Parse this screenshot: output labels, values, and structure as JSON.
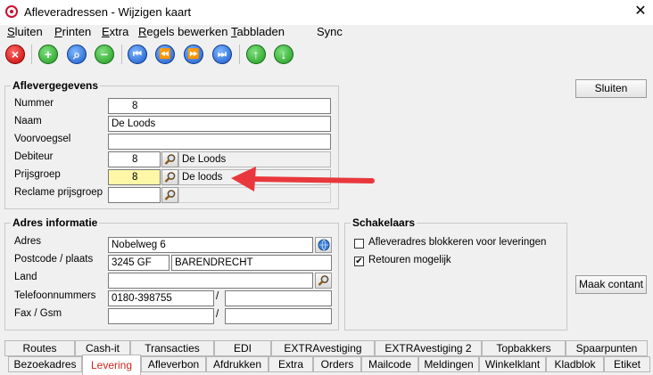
{
  "window": {
    "title": "Afleveradressen - Wijzigen kaart"
  },
  "menu": [
    {
      "label": "Sluiten",
      "u": "S",
      "rest": "luiten"
    },
    {
      "label": "Printen",
      "u": "P",
      "rest": "rinten"
    },
    {
      "label": "Extra",
      "u": "E",
      "rest": "xtra"
    },
    {
      "label": "Regels bewerken",
      "u": "R",
      "rest": "egels bewerken"
    },
    {
      "label": "Tabbladen",
      "u": "T",
      "rest": "abbladen"
    },
    {
      "label": "Sync",
      "u": "",
      "rest": "Sync"
    }
  ],
  "toolbar": {
    "delete_icon": "×",
    "add_icon": "+",
    "search_icon": "⌕",
    "remove_icon": "−",
    "first_icon": "⏮",
    "prev_icon": "⏪",
    "next_icon": "⏩",
    "last_icon": "⏭",
    "up_icon": "↑",
    "down_icon": "↓"
  },
  "aflevergegevens": {
    "title": "Aflevergegevens",
    "nummer_label": "Nummer",
    "nummer_value": "8",
    "naam_label": "Naam",
    "naam_value": "De Loods",
    "voorvoegsel_label": "Voorvoegsel",
    "voorvoegsel_value": "",
    "debiteur_label": "Debiteur",
    "debiteur_value": "8",
    "debiteur_name": "De Loods",
    "prijsgroep_label": "Prijsgroep",
    "prijsgroep_value": "8",
    "prijsgroep_name": "De loods",
    "reclame_label": "Reclame prijsgroep",
    "reclame_value": ""
  },
  "adres": {
    "title": "Adres informatie",
    "adres_label": "Adres",
    "adres_value": "Nobelweg 6",
    "postcode_label": "Postcode / plaats",
    "postcode_value": "3245 GF",
    "plaats_value": "BARENDRECHT",
    "land_label": "Land",
    "land_value": "",
    "telefoon_label": "Telefoonnummers",
    "telefoon1": "0180-398755",
    "telefoon2": "",
    "telefoon_sep": "/",
    "fax_label": "Fax / Gsm",
    "fax_value": "",
    "gsm_value": "",
    "fax_sep": "/"
  },
  "schakelaars": {
    "title": "Schakelaars",
    "opt1_label": "Afleveradres blokkeren voor leveringen",
    "opt1_checked": false,
    "opt2_label": "Retouren mogelijk",
    "opt2_checked": true,
    "check_mark": "✔"
  },
  "buttons": {
    "sluiten": "Sluiten",
    "maak_contact": "Maak contant"
  },
  "tabs_row1": [
    "Routes",
    "Cash-it",
    "Transacties",
    "EDI",
    "EXTRAvestiging",
    "EXTRAvestiging 2",
    "Topbakkers",
    "Spaarpunten"
  ],
  "tabs_row2": [
    "Bezoekadres",
    "Levering",
    "Afleverbon",
    "Afdrukken",
    "Extra",
    "Orders",
    "Mailcode",
    "Meldingen",
    "Winkelklant",
    "Kladblok",
    "Etiket"
  ],
  "active_tab": "Levering",
  "colors": {
    "accent_red": "#d0261d",
    "highlight_yellow": "#fff7a8",
    "arrow": "#e8383d"
  }
}
